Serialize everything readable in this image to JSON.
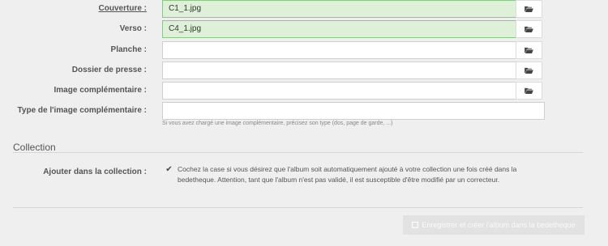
{
  "fields": {
    "couverture": {
      "label": "Couverture :",
      "value": "C1_1.jpg"
    },
    "verso": {
      "label": "Verso :",
      "value": "C4_1.jpg"
    },
    "planche": {
      "label": "Planche :",
      "value": ""
    },
    "dossier": {
      "label": "Dossier de presse :",
      "value": ""
    },
    "image_comp": {
      "label": "Image complémentaire :",
      "value": ""
    },
    "type_image": {
      "label": "Type de l'image complémentaire :",
      "value": "",
      "help": "Si vous avez chargé une image complémentaire, précisez son type (dos, page de garde, ...)"
    }
  },
  "collection": {
    "title": "Collection",
    "label": "Ajouter dans la collection :",
    "checked": true,
    "text": "Cochez la case si vous désirez que l'album soit automatiquement ajouté à votre collection une fois créé dans la bedetheque. Attention, tant que l'album n'est pas validé, il est susceptible d'être modifié par un correcteur."
  },
  "submit": {
    "label": "Enregistrer et créer l'album dans la bedetheque"
  },
  "icons": {
    "file_button": "folder-open-icon",
    "submit": "save-icon",
    "check": "checkmark-icon"
  },
  "colors": {
    "filled_bg": "#dff0d8",
    "filled_border": "#8fc48a",
    "disabled_button": "#e2e2e2"
  }
}
